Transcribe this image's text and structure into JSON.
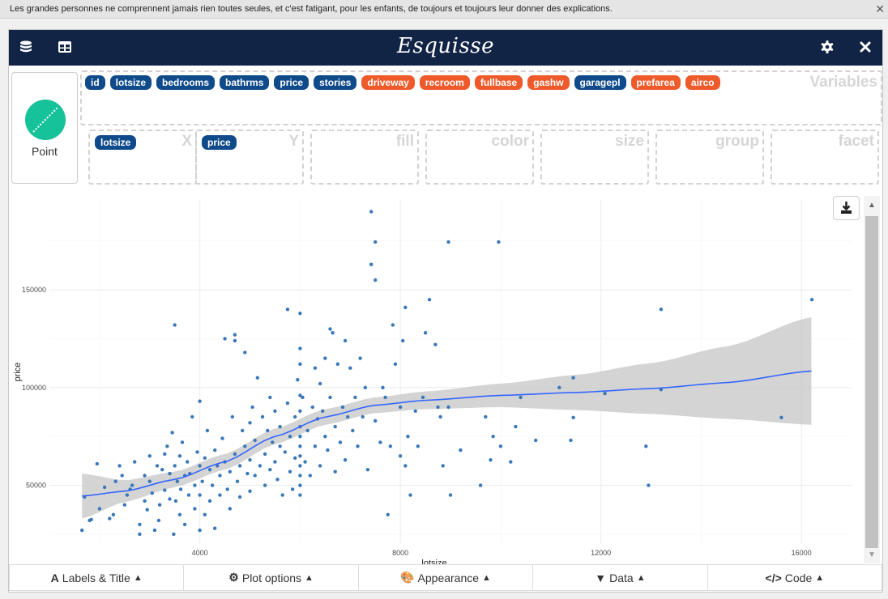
{
  "top_message": {
    "text": "Les grandes personnes ne comprennent jamais rien toutes seules, et c'est fatigant, pour les enfants, de toujours et toujours leur donner des explications.",
    "close_icon": "close-icon"
  },
  "navbar": {
    "title": "Esquisse",
    "left_icons": [
      "database-icon",
      "table-icon"
    ],
    "right_icons": [
      "gear-icon",
      "close-icon"
    ]
  },
  "geom": {
    "label": "Point",
    "icon": "point-geom-icon",
    "color": "#16c29a"
  },
  "variables": {
    "zone_label": "Variables",
    "items": [
      {
        "label": "id",
        "type": "numeric"
      },
      {
        "label": "lotsize",
        "type": "numeric"
      },
      {
        "label": "bedrooms",
        "type": "numeric"
      },
      {
        "label": "bathrms",
        "type": "numeric"
      },
      {
        "label": "price",
        "type": "numeric"
      },
      {
        "label": "stories",
        "type": "numeric"
      },
      {
        "label": "driveway",
        "type": "categorical"
      },
      {
        "label": "recroom",
        "type": "categorical"
      },
      {
        "label": "fullbase",
        "type": "categorical"
      },
      {
        "label": "gashw",
        "type": "categorical"
      },
      {
        "label": "garagepl",
        "type": "numeric"
      },
      {
        "label": "prefarea",
        "type": "categorical"
      },
      {
        "label": "airco",
        "type": "categorical"
      }
    ],
    "colors": {
      "numeric": "#0f4a8a",
      "categorical": "#ef5a2b"
    }
  },
  "aesthetics": [
    {
      "label": "X",
      "value": "lotsize"
    },
    {
      "label": "Y",
      "value": "price"
    },
    {
      "label": "fill",
      "value": null
    },
    {
      "label": "color",
      "value": null
    },
    {
      "label": "size",
      "value": null
    },
    {
      "label": "group",
      "value": null
    },
    {
      "label": "facet",
      "value": null
    }
  ],
  "plot": {
    "download_icon": "download-icon"
  },
  "bottom_bar": [
    {
      "label": "Labels & Title",
      "icon": "font-icon",
      "glyph": "A"
    },
    {
      "label": "Plot options",
      "icon": "cogs-icon",
      "glyph": "⚙"
    },
    {
      "label": "Appearance",
      "icon": "palette-icon",
      "glyph": "🎨"
    },
    {
      "label": "Data",
      "icon": "filter-icon",
      "glyph": "▼"
    },
    {
      "label": "Code",
      "icon": "code-icon",
      "glyph": "</>"
    }
  ],
  "chart_data": {
    "type": "scatter",
    "title": "",
    "xlabel": "lotsize",
    "ylabel": "price",
    "xlim": [
      1000,
      17000
    ],
    "ylim": [
      20000,
      196000
    ],
    "xticks": [
      4000,
      8000,
      12000,
      16000
    ],
    "yticks": [
      50000,
      100000,
      150000
    ],
    "xtick_labels": [
      "4000",
      "8000",
      "12000",
      "16000"
    ],
    "ytick_labels": [
      "50000",
      "100000",
      "150000"
    ],
    "grid": true,
    "point_color": "#3a78b8",
    "smooth_color": "#3366ff",
    "ribbon_color": "#cccccc",
    "points": [
      [
        1650,
        27000
      ],
      [
        1700,
        44000
      ],
      [
        1800,
        32000
      ],
      [
        1836,
        32500
      ],
      [
        1950,
        61000
      ],
      [
        2000,
        38000
      ],
      [
        2100,
        49000
      ],
      [
        2200,
        33000
      ],
      [
        2275,
        35000
      ],
      [
        2320,
        52000
      ],
      [
        2400,
        60000
      ],
      [
        2450,
        55000
      ],
      [
        2500,
        40000
      ],
      [
        2550,
        45000
      ],
      [
        2610,
        48000
      ],
      [
        2650,
        50000
      ],
      [
        2700,
        62000
      ],
      [
        2800,
        25000
      ],
      [
        2800,
        30000
      ],
      [
        2900,
        42000
      ],
      [
        2900,
        55000
      ],
      [
        2950,
        37500
      ],
      [
        3000,
        52000
      ],
      [
        3000,
        65000
      ],
      [
        3050,
        46000
      ],
      [
        3100,
        27000
      ],
      [
        3150,
        60000
      ],
      [
        3180,
        32000
      ],
      [
        3200,
        40000
      ],
      [
        3250,
        58000
      ],
      [
        3300,
        66000
      ],
      [
        3300,
        47500
      ],
      [
        3350,
        70000
      ],
      [
        3400,
        56000
      ],
      [
        3400,
        43000
      ],
      [
        3450,
        77000
      ],
      [
        3480,
        25000
      ],
      [
        3500,
        60000
      ],
      [
        3500,
        132000
      ],
      [
        3520,
        42000
      ],
      [
        3550,
        52000
      ],
      [
        3600,
        65000
      ],
      [
        3600,
        35000
      ],
      [
        3620,
        48000
      ],
      [
        3650,
        72000
      ],
      [
        3700,
        55000
      ],
      [
        3700,
        30000
      ],
      [
        3750,
        62000
      ],
      [
        3780,
        45000
      ],
      [
        3800,
        56000
      ],
      [
        3850,
        85000
      ],
      [
        3900,
        38000
      ],
      [
        3900,
        50000
      ],
      [
        3950,
        67000
      ],
      [
        4000,
        93000
      ],
      [
        4000,
        60000
      ],
      [
        4000,
        45000
      ],
      [
        4000,
        27000
      ],
      [
        4050,
        52000
      ],
      [
        4100,
        64000
      ],
      [
        4100,
        35000
      ],
      [
        4150,
        78000
      ],
      [
        4200,
        58000
      ],
      [
        4200,
        42000
      ],
      [
        4250,
        50000
      ],
      [
        4300,
        68000
      ],
      [
        4300,
        28000
      ],
      [
        4350,
        60000
      ],
      [
        4400,
        55000
      ],
      [
        4400,
        45000
      ],
      [
        4450,
        74000
      ],
      [
        4500,
        125000
      ],
      [
        4500,
        62000
      ],
      [
        4550,
        48000
      ],
      [
        4600,
        57000
      ],
      [
        4600,
        38000
      ],
      [
        4650,
        85000
      ],
      [
        4700,
        124000
      ],
      [
        4700,
        127000
      ],
      [
        4700,
        66000
      ],
      [
        4750,
        52000
      ],
      [
        4800,
        60000
      ],
      [
        4800,
        44000
      ],
      [
        4850,
        78000
      ],
      [
        4900,
        118000
      ],
      [
        4900,
        70000
      ],
      [
        4950,
        56000
      ],
      [
        5000,
        82000
      ],
      [
        5000,
        63000
      ],
      [
        5000,
        47000
      ],
      [
        5050,
        90000
      ],
      [
        5100,
        73000
      ],
      [
        5100,
        55000
      ],
      [
        5150,
        105000
      ],
      [
        5200,
        60000
      ],
      [
        5250,
        85000
      ],
      [
        5300,
        66000
      ],
      [
        5300,
        50000
      ],
      [
        5350,
        78000
      ],
      [
        5400,
        95000
      ],
      [
        5400,
        58000
      ],
      [
        5450,
        72000
      ],
      [
        5500,
        88000
      ],
      [
        5500,
        62000
      ],
      [
        5550,
        53000
      ],
      [
        5600,
        80000
      ],
      [
        5600,
        70000
      ],
      [
        5650,
        45000
      ],
      [
        5700,
        67000
      ],
      [
        5750,
        140000
      ],
      [
        5750,
        92000
      ],
      [
        5800,
        75000
      ],
      [
        5800,
        57000
      ],
      [
        5850,
        48000
      ],
      [
        5900,
        85000
      ],
      [
        5900,
        64000
      ],
      [
        5950,
        104000
      ],
      [
        6000,
        120000
      ],
      [
        6000,
        112000
      ],
      [
        6000,
        96000
      ],
      [
        6000,
        88000
      ],
      [
        6000,
        80000
      ],
      [
        6000,
        75000
      ],
      [
        6000,
        70000
      ],
      [
        6000,
        65000
      ],
      [
        6000,
        60000
      ],
      [
        6000,
        55000
      ],
      [
        6000,
        50000
      ],
      [
        6000,
        45000
      ],
      [
        6000,
        138000
      ],
      [
        6050,
        95000
      ],
      [
        6100,
        62000
      ],
      [
        6150,
        78000
      ],
      [
        6200,
        55000
      ],
      [
        6250,
        90000
      ],
      [
        6300,
        110000
      ],
      [
        6300,
        70000
      ],
      [
        6350,
        84000
      ],
      [
        6400,
        102000
      ],
      [
        6400,
        60000
      ],
      [
        6450,
        88000
      ],
      [
        6500,
        115000
      ],
      [
        6500,
        75000
      ],
      [
        6550,
        68000
      ],
      [
        6600,
        130000
      ],
      [
        6600,
        95000
      ],
      [
        6650,
        128000
      ],
      [
        6700,
        80000
      ],
      [
        6700,
        57000
      ],
      [
        6750,
        112000
      ],
      [
        6800,
        72000
      ],
      [
        6850,
        90000
      ],
      [
        6900,
        124000
      ],
      [
        6900,
        63000
      ],
      [
        6950,
        85000
      ],
      [
        7000,
        110000
      ],
      [
        7050,
        78000
      ],
      [
        7100,
        95000
      ],
      [
        7150,
        70000
      ],
      [
        7200,
        115000
      ],
      [
        7250,
        85000
      ],
      [
        7300,
        100000
      ],
      [
        7350,
        58000
      ],
      [
        7420,
        190000
      ],
      [
        7420,
        163000
      ],
      [
        7500,
        174500
      ],
      [
        7500,
        155000
      ],
      [
        7500,
        83000
      ],
      [
        7600,
        72000
      ],
      [
        7650,
        100000
      ],
      [
        7700,
        95000
      ],
      [
        7750,
        35000
      ],
      [
        7800,
        70000
      ],
      [
        7850,
        132000
      ],
      [
        7900,
        112000
      ],
      [
        8000,
        90000
      ],
      [
        8000,
        65000
      ],
      [
        8050,
        124000
      ],
      [
        8100,
        141000
      ],
      [
        8100,
        60000
      ],
      [
        8150,
        75000
      ],
      [
        8200,
        45000
      ],
      [
        8300,
        88000
      ],
      [
        8350,
        70000
      ],
      [
        8450,
        95000
      ],
      [
        8500,
        128000
      ],
      [
        8580,
        145000
      ],
      [
        8700,
        122000
      ],
      [
        8750,
        90000
      ],
      [
        8800,
        85000
      ],
      [
        8850,
        60000
      ],
      [
        8960,
        174500
      ],
      [
        8960,
        90000
      ],
      [
        9000,
        45000
      ],
      [
        9200,
        68000
      ],
      [
        9600,
        50000
      ],
      [
        9700,
        85000
      ],
      [
        9800,
        63000
      ],
      [
        9850,
        75000
      ],
      [
        9960,
        174500
      ],
      [
        10000,
        70000
      ],
      [
        10200,
        62000
      ],
      [
        10300,
        80000
      ],
      [
        10400,
        95000
      ],
      [
        10700,
        73000
      ],
      [
        11170,
        100000
      ],
      [
        11400,
        73000
      ],
      [
        11450,
        105000
      ],
      [
        11450,
        84700
      ],
      [
        12080,
        97000
      ],
      [
        12900,
        70000
      ],
      [
        12950,
        50000
      ],
      [
        13200,
        140000
      ],
      [
        13200,
        99000
      ],
      [
        15600,
        84700
      ],
      [
        16210,
        145000
      ]
    ],
    "smooth_line": {
      "x": [
        1650,
        2500,
        3500,
        4500,
        5500,
        6500,
        7500,
        8500,
        10000,
        11500,
        13000,
        14500,
        16200
      ],
      "y": [
        44500,
        47000,
        53000,
        62000,
        75000,
        85000,
        91000,
        93500,
        96000,
        97500,
        99500,
        102500,
        108500
      ],
      "ymin": [
        33000,
        41500,
        49000,
        58000,
        71000,
        81000,
        87000,
        89000,
        90000,
        88500,
        86500,
        84000,
        81000
      ],
      "ymax": [
        56000,
        52500,
        57000,
        66000,
        79000,
        89000,
        95000,
        98000,
        102000,
        106500,
        112500,
        121000,
        136000
      ]
    }
  }
}
